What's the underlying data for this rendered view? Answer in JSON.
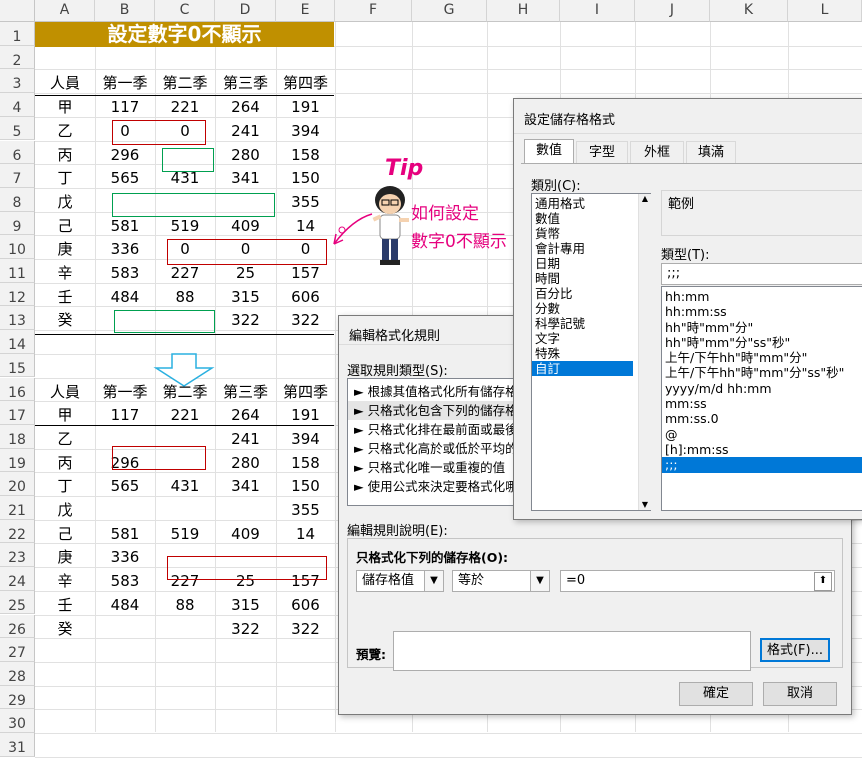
{
  "columns": [
    "A",
    "B",
    "C",
    "D",
    "E",
    "F",
    "G",
    "H",
    "I",
    "J",
    "K",
    "L"
  ],
  "rows": [
    "1",
    "2",
    "3",
    "4",
    "5",
    "6",
    "7",
    "8",
    "9",
    "10",
    "11",
    "12",
    "13",
    "14",
    "15",
    "16",
    "17",
    "18",
    "19",
    "20",
    "21",
    "22",
    "23",
    "24",
    "25",
    "26",
    "27",
    "28",
    "29",
    "30",
    "31"
  ],
  "title": "設定數字0不顯示",
  "top_table": {
    "headers": [
      "人員",
      "第一季",
      "第二季",
      "第三季",
      "第四季"
    ],
    "rows": [
      [
        "甲",
        "117",
        "221",
        "264",
        "191"
      ],
      [
        "乙",
        "0",
        "0",
        "241",
        "394"
      ],
      [
        "丙",
        "296",
        "",
        "280",
        "158"
      ],
      [
        "丁",
        "565",
        "431",
        "341",
        "150"
      ],
      [
        "戊",
        "",
        "",
        "",
        "355"
      ],
      [
        "己",
        "581",
        "519",
        "409",
        "14"
      ],
      [
        "庚",
        "336",
        "0",
        "0",
        "0"
      ],
      [
        "辛",
        "583",
        "227",
        "25",
        "157"
      ],
      [
        "壬",
        "484",
        "88",
        "315",
        "606"
      ],
      [
        "癸",
        "",
        "",
        "322",
        "322"
      ]
    ]
  },
  "bottom_table": {
    "headers": [
      "人員",
      "第一季",
      "第二季",
      "第三季",
      "第四季"
    ],
    "rows": [
      [
        "甲",
        "117",
        "221",
        "264",
        "191"
      ],
      [
        "乙",
        "",
        "",
        "241",
        "394"
      ],
      [
        "丙",
        "296",
        "",
        "280",
        "158"
      ],
      [
        "丁",
        "565",
        "431",
        "341",
        "150"
      ],
      [
        "戊",
        "",
        "",
        "",
        "355"
      ],
      [
        "己",
        "581",
        "519",
        "409",
        "14"
      ],
      [
        "庚",
        "336",
        "",
        "",
        ""
      ],
      [
        "辛",
        "583",
        "227",
        "25",
        "157"
      ],
      [
        "壬",
        "484",
        "88",
        "315",
        "606"
      ],
      [
        "癸",
        "",
        "",
        "322",
        "322"
      ]
    ]
  },
  "tip": {
    "badge": "Tip",
    "line1": "如何設定",
    "line2": "數字0不顯示",
    "color": "#e6007e"
  },
  "format_cells_dialog": {
    "title": "設定儲存格格式",
    "tabs": [
      "數值",
      "字型",
      "外框",
      "填滿"
    ],
    "category_label": "類別(C):",
    "categories": [
      "通用格式",
      "數值",
      "貨幣",
      "會計專用",
      "日期",
      "時間",
      "百分比",
      "分數",
      "科學記號",
      "文字",
      "特殊",
      "自訂"
    ],
    "selected_category": "自訂",
    "sample_label": "範例",
    "type_label": "類型(T):",
    "type_value": ";;;",
    "type_list": [
      "hh:mm",
      "hh:mm:ss",
      "hh\"時\"mm\"分\"",
      "hh\"時\"mm\"分\"ss\"秒\"",
      "上午/下午hh\"時\"mm\"分\"",
      "上午/下午hh\"時\"mm\"分\"ss\"秒\"",
      "yyyy/m/d hh:mm",
      "mm:ss",
      "mm:ss.0",
      "@",
      "[h]:mm:ss",
      ";;;"
    ],
    "selected_type": ";;;"
  },
  "cf_dialog": {
    "title": "編輯格式化規則",
    "select_type_label": "選取規則類型(S):",
    "rule_types": [
      "► 根據其值格式化所有儲存格",
      "► 只格式化包含下列的儲存格",
      "► 只格式化排在最前面或最後",
      "► 只格式化高於或低於平均的",
      "► 只格式化唯一或重複的值",
      "► 使用公式來決定要格式化哪"
    ],
    "selected_rule": 1,
    "edit_desc_label": "編輯規則說明(E):",
    "only_format_label": "只格式化下列的儲存格(O):",
    "cond1": "儲存格值",
    "cond2": "等於",
    "cond_value": "=0",
    "preview_label": "預覽:",
    "format_button": "格式(F)...",
    "ok": "確定",
    "cancel": "取消"
  },
  "colors": {
    "title_bg": "#c09000",
    "red_box": "#c00000",
    "green_box": "#00a050",
    "selection": "#0078d7"
  }
}
